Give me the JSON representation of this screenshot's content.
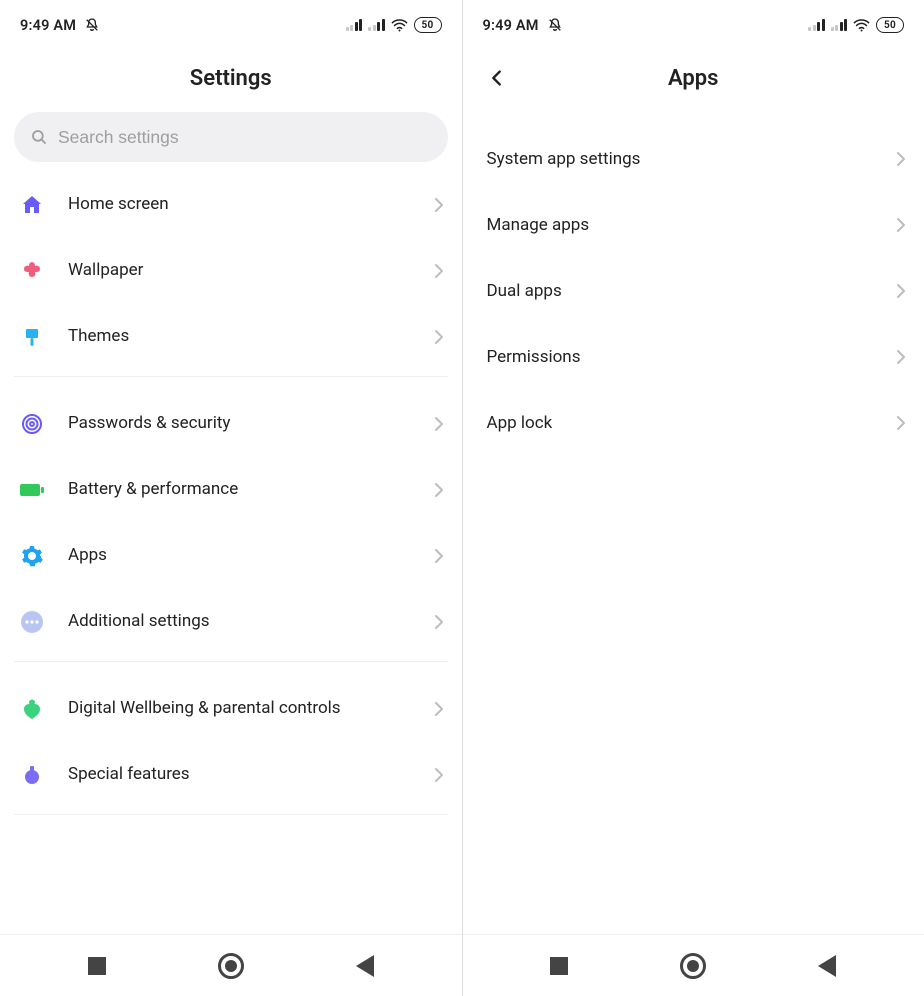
{
  "status": {
    "time": "9:49 AM",
    "battery_level": "50"
  },
  "left": {
    "title": "Settings",
    "search_placeholder": "Search settings",
    "groups": [
      {
        "items": [
          {
            "id": "home-screen",
            "label": "Home screen",
            "icon": "home",
            "color": "#6a5af6"
          },
          {
            "id": "wallpaper",
            "label": "Wallpaper",
            "icon": "flower",
            "color": "#ef5f7d"
          },
          {
            "id": "themes",
            "label": "Themes",
            "icon": "brush",
            "color": "#2bb1f0"
          }
        ]
      },
      {
        "items": [
          {
            "id": "passwords",
            "label": "Passwords & security",
            "icon": "fingerprint",
            "color": "#6a5af6"
          },
          {
            "id": "battery",
            "label": "Battery & performance",
            "icon": "battery",
            "color": "#32c85a"
          },
          {
            "id": "apps",
            "label": "Apps",
            "icon": "gear",
            "color": "#1fa2f0"
          },
          {
            "id": "additional",
            "label": "Additional settings",
            "icon": "dots",
            "color": "#b9c6f2"
          }
        ]
      },
      {
        "items": [
          {
            "id": "wellbeing",
            "label": "Digital Wellbeing & parental controls",
            "icon": "wellbeing",
            "color": "#3bd37e"
          },
          {
            "id": "special",
            "label": "Special features",
            "icon": "flask",
            "color": "#7a6df4"
          }
        ]
      }
    ]
  },
  "right": {
    "title": "Apps",
    "items": [
      {
        "id": "system-app-settings",
        "label": "System app settings"
      },
      {
        "id": "manage-apps",
        "label": "Manage apps"
      },
      {
        "id": "dual-apps",
        "label": "Dual apps"
      },
      {
        "id": "permissions",
        "label": "Permissions"
      },
      {
        "id": "app-lock",
        "label": "App lock"
      }
    ]
  }
}
